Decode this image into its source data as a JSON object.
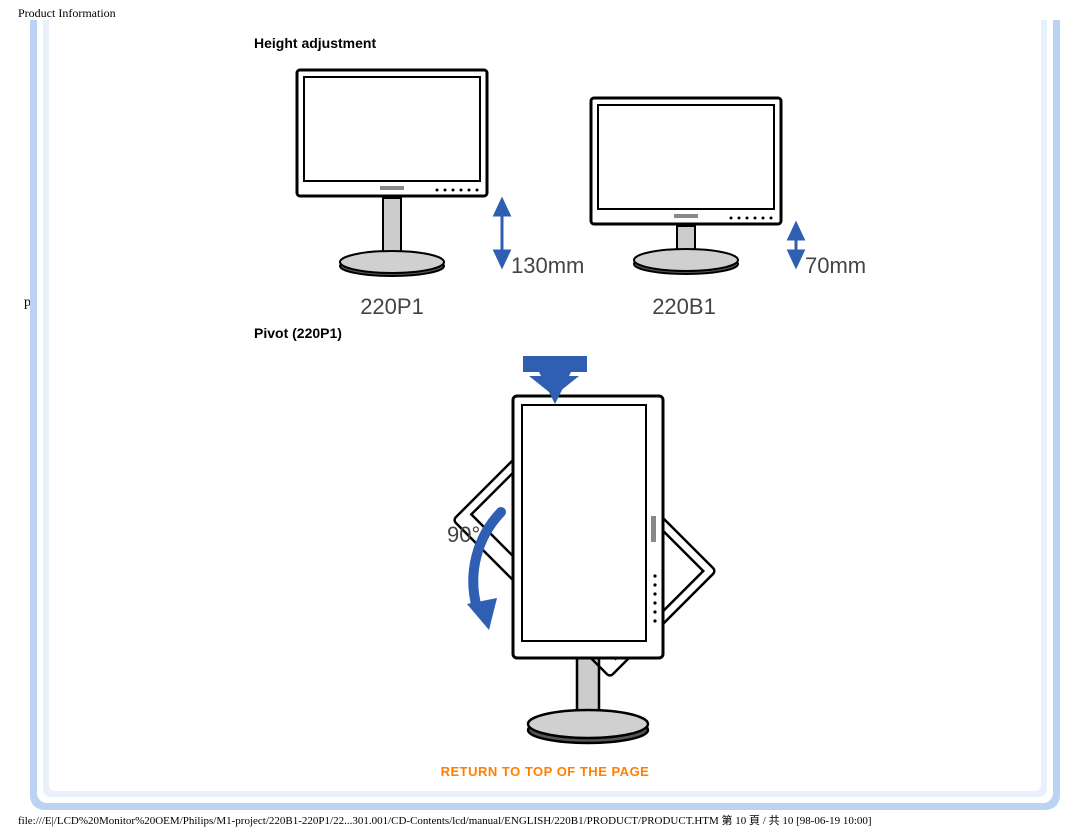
{
  "page_header": "Product Information",
  "page_footer": "file:///E|/LCD%20Monitor%20OEM/Philips/M1-project/220B1-220P1/22...301.001/CD-Contents/lcd/manual/ENGLISH/220B1/PRODUCT/PRODUCT.HTM 第 10 頁 / 共 10 [98-06-19 10:00]",
  "stray_char": "p",
  "sections": {
    "height_adjustment": {
      "title": "Height adjustment",
      "figures": [
        {
          "model": "220P1",
          "height_label": "130mm"
        },
        {
          "model": "220B1",
          "height_label": "70mm"
        }
      ]
    },
    "pivot": {
      "title": "Pivot (220P1)",
      "angle_label": "90°"
    }
  },
  "return_link": "RETURN TO TOP OF THE PAGE"
}
